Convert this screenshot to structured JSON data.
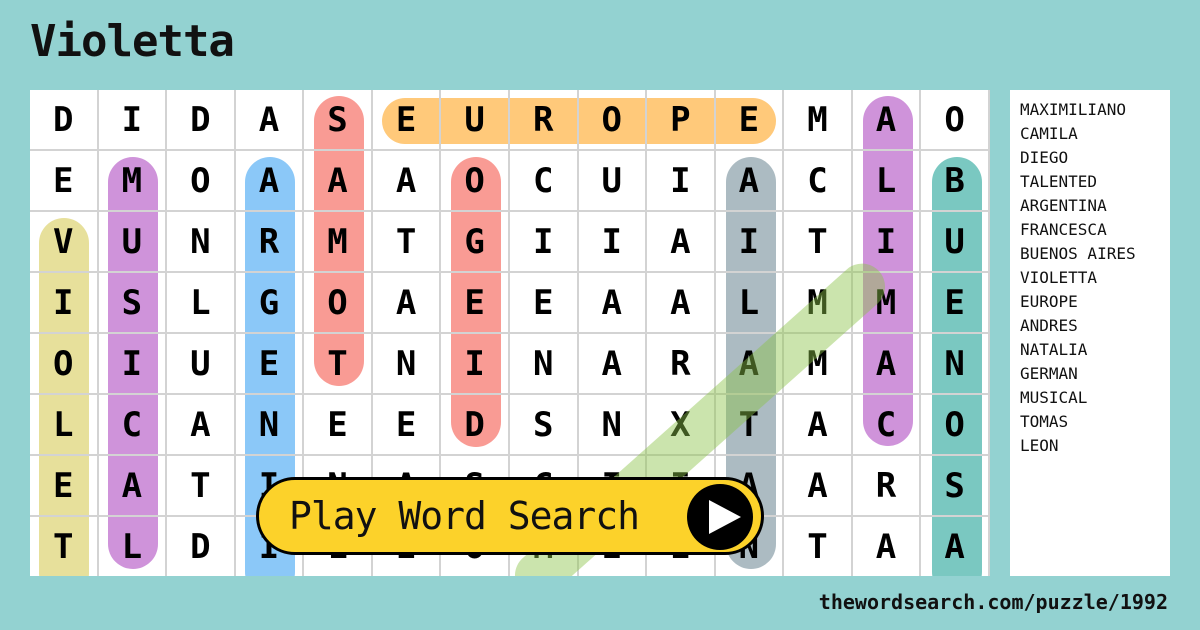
{
  "title": "Violetta",
  "grid": [
    [
      "D",
      "I",
      "D",
      "A",
      "S",
      "E",
      "U",
      "R",
      "O",
      "P",
      "E",
      "M",
      "A",
      "O"
    ],
    [
      "E",
      "M",
      "O",
      "A",
      "A",
      "A",
      "O",
      "C",
      "U",
      "I",
      "A",
      "C",
      "L",
      "B"
    ],
    [
      "V",
      "U",
      "N",
      "R",
      "M",
      "T",
      "G",
      "I",
      "I",
      "A",
      "I",
      "T",
      "I",
      "U"
    ],
    [
      "I",
      "S",
      "L",
      "G",
      "O",
      "A",
      "E",
      "E",
      "A",
      "A",
      "L",
      "M",
      "M",
      "E"
    ],
    [
      "O",
      "I",
      "U",
      "E",
      "T",
      "N",
      "I",
      "N",
      "A",
      "R",
      "A",
      "M",
      "A",
      "N"
    ],
    [
      "L",
      "C",
      "A",
      "N",
      "E",
      "E",
      "D",
      "S",
      "N",
      "X",
      "T",
      "A",
      "C",
      "O"
    ],
    [
      "E",
      "A",
      "T",
      "I",
      "N",
      "A",
      "S",
      "C",
      "I",
      "I",
      "A",
      "A",
      "R",
      "S"
    ],
    [
      "T",
      "L",
      "D",
      "I",
      "L",
      "E",
      "O",
      "M",
      "E",
      "E",
      "N",
      "T",
      "A",
      "A"
    ]
  ],
  "highlights": [
    {
      "word": "VIOLETTA",
      "color": "#dfd57a"
    },
    {
      "word": "MUSICAL",
      "color": "#bf6fcd"
    },
    {
      "word": "ARGENTINA",
      "color": "#64b5f6"
    },
    {
      "word": "SAMOT",
      "color": "#f77a70"
    },
    {
      "word": "EUROPE",
      "color": "#ffb74d"
    },
    {
      "word": "OGEID",
      "color": "#f77a70"
    },
    {
      "word": "AILATAN",
      "color": "#90a4ae"
    },
    {
      "word": "ALIMAC",
      "color": "#bf6fcd"
    },
    {
      "word": "BUENOSA",
      "color": "#4db6ac"
    },
    {
      "word": "MAXIMILIANO",
      "color": "#aed581"
    }
  ],
  "word_list": [
    "MAXIMILIANO",
    "CAMILA",
    "DIEGO",
    "TALENTED",
    "ARGENTINA",
    "FRANCESCA",
    "BUENOS AIRES",
    "VIOLETTA",
    "EUROPE",
    "ANDRES",
    "NATALIA",
    "GERMAN",
    "MUSICAL",
    "TOMAS",
    "LEON"
  ],
  "play_button": {
    "label": "Play Word Search",
    "icon": "play-icon"
  },
  "footer_url": "thewordsearch.com/puzzle/1992"
}
